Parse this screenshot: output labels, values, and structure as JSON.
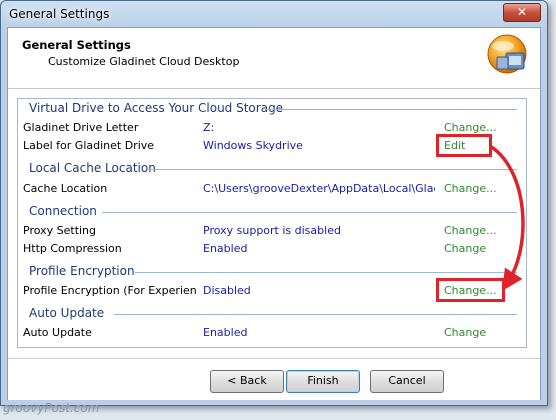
{
  "window": {
    "title": "General Settings"
  },
  "header": {
    "title": "General Settings",
    "subtitle": "Customize Gladinet Cloud Desktop"
  },
  "sections": [
    {
      "title": "Virtual Drive to Access Your Cloud Storage",
      "rows": [
        {
          "label": "Gladinet Drive Letter",
          "value": "Z:",
          "action": "Change..."
        },
        {
          "label": "Label for Gladinet Drive",
          "value": "Windows Skydrive",
          "action": "Edit"
        }
      ]
    },
    {
      "title": "Local Cache Location",
      "rows": [
        {
          "label": "Cache Location",
          "value": "C:\\Users\\grooveDexter\\AppData\\Local\\Gladi...",
          "action": "Change..."
        }
      ]
    },
    {
      "title": "Connection",
      "rows": [
        {
          "label": "Proxy Setting",
          "value": "Proxy support is disabled",
          "action": "Change..."
        },
        {
          "label": "Http Compression",
          "value": "Enabled",
          "action": "Change"
        }
      ]
    },
    {
      "title": "Profile Encryption",
      "rows": [
        {
          "label": "Profile Encryption (For Experienc...",
          "value": "Disabled",
          "action": "Change..."
        }
      ]
    },
    {
      "title": "Auto Update",
      "rows": [
        {
          "label": "Auto Update",
          "value": "Enabled",
          "action": "Change"
        }
      ]
    }
  ],
  "buttons": {
    "back": "< Back",
    "finish": "Finish",
    "cancel": "Cancel"
  },
  "watermark": "groovyPost.com",
  "colors": {
    "link_green": "#2e8b2e",
    "value_blue": "#1a1aa8",
    "highlight_red": "#e0232a"
  },
  "icons": {
    "close": "close-icon",
    "logo": "gladinet-logo-icon"
  }
}
